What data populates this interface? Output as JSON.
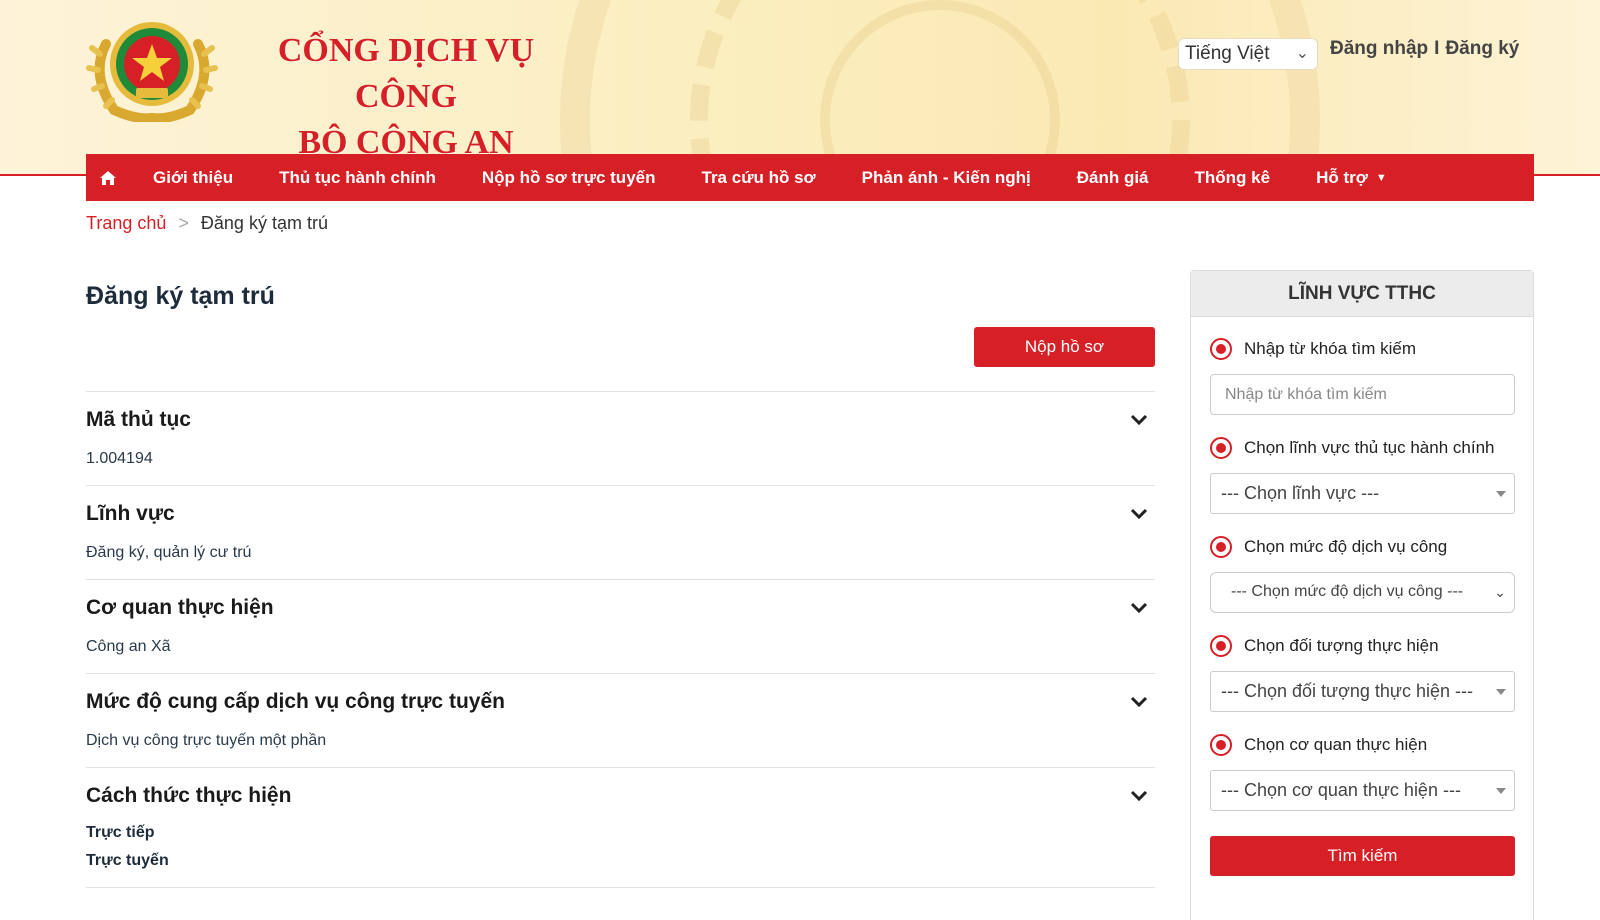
{
  "header": {
    "title_line1": "CỔNG DỊCH VỤ CÔNG",
    "title_line2": "BỘ CÔNG AN",
    "language": "Tiếng Việt",
    "login": "Đăng nhập",
    "separator": "I",
    "register": "Đăng ký"
  },
  "nav": {
    "items": [
      "Giới thiệu",
      "Thủ tục hành chính",
      "Nộp hồ sơ trực tuyến",
      "Tra cứu hồ sơ",
      "Phản ánh - Kiến nghị",
      "Đánh giá",
      "Thống kê",
      "Hỗ trợ"
    ]
  },
  "breadcrumb": {
    "home": "Trang chủ",
    "separator": ">",
    "current": "Đăng ký tạm trú"
  },
  "main": {
    "title": "Đăng ký tạm trú",
    "submit_label": "Nộp hồ sơ",
    "sections": [
      {
        "title": "Mã thủ tục",
        "values": [
          "1.004194"
        ]
      },
      {
        "title": "Lĩnh vực",
        "values": [
          "Đăng ký, quản lý cư trú"
        ]
      },
      {
        "title": "Cơ quan thực hiện",
        "values": [
          "Công an Xã"
        ]
      },
      {
        "title": "Mức độ cung cấp dịch vụ công trực tuyến",
        "values": [
          "Dịch vụ công trực tuyến một phần"
        ]
      },
      {
        "title": "Cách thức thực hiện",
        "values": [
          "Trực tiếp",
          "Trực tuyến"
        ]
      }
    ]
  },
  "sidebar": {
    "title": "LĨNH VỰC TTHC",
    "keyword_label": "Nhập từ khóa tìm kiếm",
    "keyword_placeholder": "Nhập từ khóa tìm kiếm",
    "field_label": "Chọn lĩnh vực thủ tục hành chính",
    "field_value": "--- Chọn lĩnh vực ---",
    "level_label": "Chọn mức độ dịch vụ công",
    "level_value": "--- Chọn mức độ dịch vụ công ---",
    "subject_label": "Chọn đối tượng thực hiện",
    "subject_value": "--- Chọn đối tượng thực hiện ---",
    "agency_label": "Chọn cơ quan thực hiện",
    "agency_value": "--- Chọn cơ quan thực hiện ---",
    "search_label": "Tìm kiếm"
  },
  "colors": {
    "brand_red": "#d71f26",
    "header_bg": "#fbeebf",
    "emblem_gold": "#e0b53a",
    "emblem_green": "#1e8a3a"
  }
}
